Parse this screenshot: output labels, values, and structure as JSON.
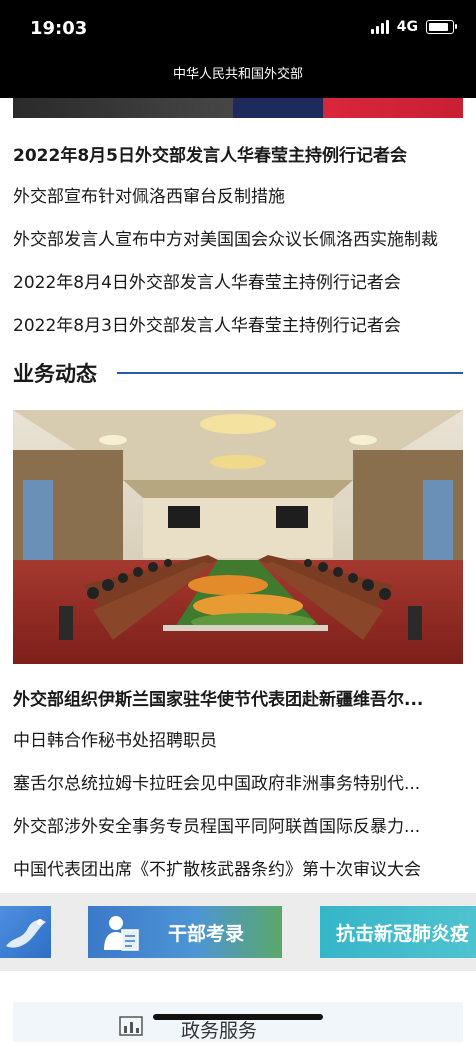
{
  "status_bar": {
    "time": "19:03",
    "network": "4G",
    "battery_level": 0.85
  },
  "header": {
    "title": "中华人民共和国外交部"
  },
  "news_list_1": [
    "2022年8月5日外交部发言人华春莹主持例行记者会",
    "外交部宣布针对佩洛西窜台反制措施",
    "外交部发言人宣布中方对美国国会众议长佩洛西实施制裁",
    "2022年8月4日外交部发言人华春莹主持例行记者会",
    "2022年8月3日外交部发言人华春莹主持例行记者会"
  ],
  "section": {
    "title": "业务动态"
  },
  "news_list_2": [
    "外交部组织伊斯兰国家驻华使节代表团赴新疆维吾尔...",
    "中日韩合作秘书处招聘职员",
    "塞舌尔总统拉姆卡拉旺会见中国政府非洲事务特别代...",
    "外交部涉外安全事务专员程国平同阿联酋国际反暴力...",
    "中国代表团出席《不扩散核武器条约》第十次审议大会"
  ],
  "banners": {
    "mid_label": "干部考录",
    "right_label": "抗击新冠肺炎疫"
  },
  "service": {
    "label": "政务服务"
  },
  "colors": {
    "accent": "#2d5aa6",
    "header_bg": "#000000"
  }
}
